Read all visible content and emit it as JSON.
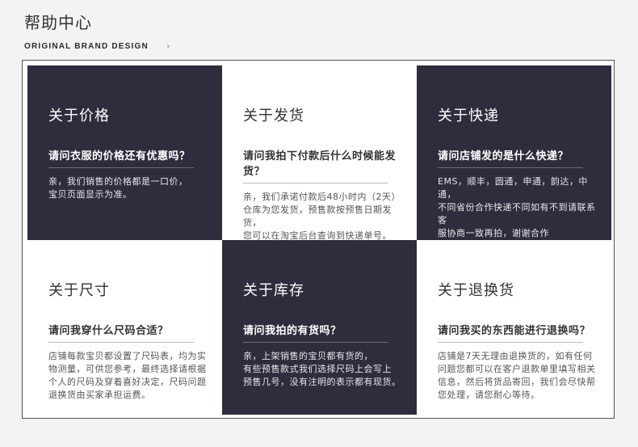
{
  "header": {
    "title": "帮助中心",
    "subtitle": "ORIGINAL BRAND DESIGN",
    "chevron": "›"
  },
  "colors": {
    "dark_card": "#2e2d3d",
    "light_card": "#ffffff",
    "page_bg": "#f3f3f3"
  },
  "cards": [
    {
      "title": "关于价格",
      "question": "请问衣服的价格还有优惠吗？",
      "answer": "亲，我们销售的价格都是一口价，\n宝贝页面显示为准。",
      "theme": "dark"
    },
    {
      "title": "关于发货",
      "question": "请问我拍下付款后什么时候能发货？",
      "answer": "亲，我们承诺付款后48小时内（2天）\n仓库为您发货，预售款按预售日期发货，\n您可以在淘宝后台查询到快递单号。",
      "theme": "light"
    },
    {
      "title": "关于快递",
      "question": "请问店铺发的是什么快递？",
      "answer": "EMS，顺丰，圆通，申通，韵达，中通，\n不同省份合作快递不同如有不到请联系客\n服协商一致再拍，谢谢合作",
      "theme": "dark"
    },
    {
      "title": "关于尺寸",
      "question": "请问我穿什么尺码合适？",
      "answer": "店铺每款宝贝都设置了尺码表，均为实\n物测量，可供您参考，最终选择请根据\n个人的尺码及穿着喜好决定，尺码问题\n退换货由买家承担运费。",
      "theme": "light"
    },
    {
      "title": "关于库存",
      "question": "请问我拍的有货吗？",
      "answer": "亲，上架销售的宝贝都有货的，\n有些预售款式我们选择尺码上会写上\n预售几号，没有注明的表示都有现货。",
      "theme": "dark"
    },
    {
      "title": "关于退换货",
      "question": "请问我买的东西能进行退换吗？",
      "answer": "店铺是7天无理由退换货的，如有任何\n问题您都可以在客户退款单里填写相关\n信息，然后将货品寄回，我们会尽快帮\n您处理，请您耐心等待。",
      "theme": "light"
    }
  ]
}
